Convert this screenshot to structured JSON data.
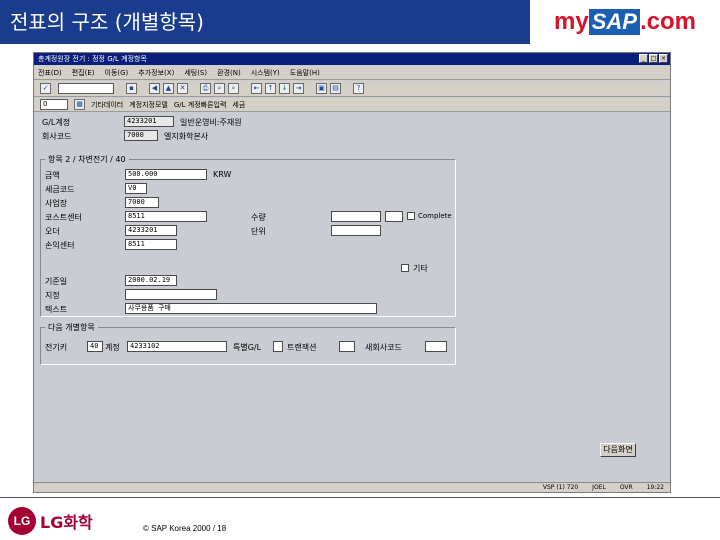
{
  "slide": {
    "title": "전표의 구조 (개별항목)"
  },
  "logo": {
    "my": "my",
    "sap": "SAP",
    "com": ".com"
  },
  "window": {
    "title": "총계정원장 전기 : 정정 G/L 계정항목",
    "menu": [
      "전표(D)",
      "편집(E)",
      "이동(G)",
      "추가정보(X)",
      "세팅(S)",
      "환경(N)",
      "시스템(Y)",
      "도움말(H)"
    ],
    "command_placeholder": ""
  },
  "app_toolbar": {
    "doc_number": "0",
    "items": [
      "기타데이터",
      "계정지정모델",
      "G/L 계정빠른입력",
      "세금"
    ]
  },
  "header": {
    "gl_account_label": "G/L계정",
    "gl_account_value": "4233201",
    "gl_account_desc": "일반운영비:주재원",
    "company_code_label": "회사코드",
    "company_code_value": "7000",
    "company_code_desc": "엘지화학본사"
  },
  "item_group": {
    "title": "항목 2 / 차변전기 / 40",
    "amount_label": "금액",
    "amount_value": "500.000",
    "currency": "KRW",
    "tax_code_label": "세금코드",
    "tax_code_value": "V0",
    "business_area_label": "사업장",
    "business_area_value": "7000",
    "cost_center_label": "코스트센터",
    "cost_center_value": "8511",
    "order_label": "오더",
    "order_value": "4233201",
    "profit_center_label": "손익센터",
    "profit_center_value": "8511",
    "quantity_label": "수량",
    "unit_label": "단위",
    "complete_label": "Complete",
    "more_label": "기타",
    "value_date_label": "기준일",
    "value_date_value": "2000.02.19",
    "assignment_label": "지정",
    "text_label": "텍스트",
    "text_value": "사무용품 구매"
  },
  "next_item": {
    "title": "다음 개별항목",
    "posting_key_label": "전기키",
    "posting_key_value": "40",
    "account_label": "계정",
    "account_value": "4233102",
    "special_gl_label": "특별G/L",
    "trans_type_label": "트랜잭션",
    "new_cocode_label": "새회사코드"
  },
  "next_button": "다음화면",
  "status": {
    "system": "VSP (1) 720",
    "server": "JOEL",
    "mode": "OVR",
    "time": "19:22"
  },
  "footer": {
    "company": "LG화학",
    "copyright": "© SAP Korea 2000 / 18"
  },
  "colors": {
    "header_bg": "#1a3c8c",
    "sap_bg": "#c9ccd2",
    "lg_red": "#a50034"
  }
}
